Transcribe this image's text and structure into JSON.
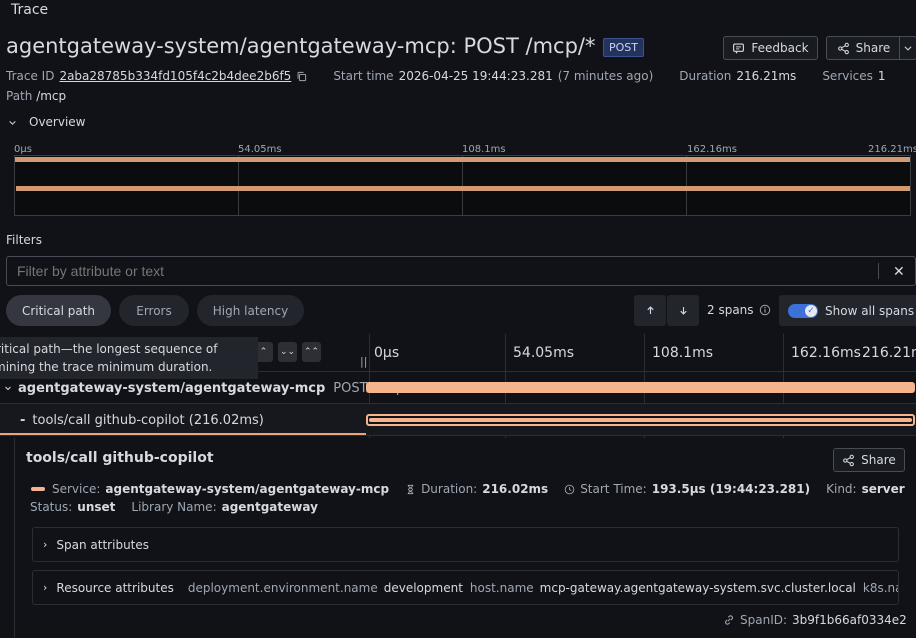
{
  "header": {
    "section_label": "Trace",
    "title": "agentgateway-system/agentgateway-mcp: POST /mcp/*",
    "method_badge": "POST",
    "feedback_label": "Feedback",
    "share_label": "Share"
  },
  "meta": {
    "trace_id_label": "Trace ID",
    "trace_id": "2aba28785b334fd105f4c2b4dee2b6f5",
    "start_time_label": "Start time",
    "start_time": "2026-04-25 19:44:23.281",
    "start_time_relative": "(7 minutes ago)",
    "duration_label": "Duration",
    "duration": "216.21ms",
    "services_label": "Services",
    "services": "1",
    "path_label": "Path",
    "path": "/mcp"
  },
  "overview": {
    "label": "Overview",
    "ticks": [
      "0μs",
      "54.05ms",
      "108.1ms",
      "162.16ms",
      "216.21ms"
    ]
  },
  "filters": {
    "label": "Filters",
    "placeholder": "Filter by attribute or text",
    "pills": [
      "Critical path",
      "Errors",
      "High latency"
    ],
    "active_pill": "Critical path",
    "span_count": "2 spans",
    "show_all_label": "Show all spans",
    "show_all_enabled": true
  },
  "tooltip": {
    "line1": "ritical path—the longest sequence of",
    "line2": "mining the trace minimum duration."
  },
  "timeline": {
    "ticks": [
      "0μs",
      "54.05ms",
      "108.1ms",
      "162.16ms",
      "216.21m"
    ],
    "spans": [
      {
        "service": "agentgateway-system/agentgateway-mcp",
        "operation": "POST /mcp/*",
        "start_ms": 0,
        "duration_ms": 216.21
      },
      {
        "service": "",
        "operation": "tools/call github-copilot (216.02ms)",
        "start_ms": 0.19,
        "duration_ms": 216.02
      }
    ]
  },
  "detail": {
    "title": "tools/call github-copilot",
    "share_label": "Share",
    "service_label": "Service:",
    "service": "agentgateway-system/agentgateway-mcp",
    "duration_label": "Duration:",
    "duration": "216.02ms",
    "start_label": "Start Time:",
    "start": "193.5μs (19:44:23.281)",
    "kind_label": "Kind:",
    "kind": "server",
    "status_label": "Status:",
    "status": "unset",
    "library_label": "Library Name:",
    "library": "agentgateway",
    "span_attributes_label": "Span attributes",
    "resource_attributes_label": "Resource attributes",
    "resource_attrs": [
      {
        "key": "deployment.environment.name",
        "value": "development"
      },
      {
        "key": "host.name",
        "value": "mcp-gateway.agentgateway-system.svc.cluster.local"
      },
      {
        "key": "k8s.na...",
        "value": ""
      }
    ],
    "span_id_label": "SpanID:",
    "span_id": "3b9f1b66af0334e2"
  },
  "colors": {
    "span_bar": "#f4b58e",
    "minimap_bar": "#d29a72",
    "toggle_on": "#3d71d9",
    "badge_bg": "#24335a"
  }
}
